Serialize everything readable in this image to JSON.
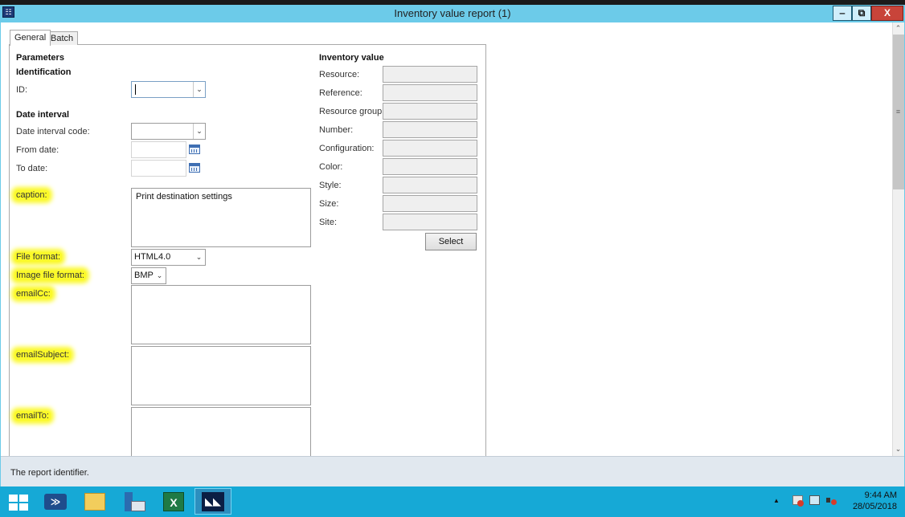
{
  "window": {
    "title": "Inventory value report (1)",
    "app_icon": "☷",
    "controls": {
      "minimize": "‒",
      "maximize": "⧉",
      "close": "X"
    }
  },
  "tabs": [
    {
      "label": "General",
      "active": true
    },
    {
      "label": "Batch",
      "active": false
    }
  ],
  "parameters": {
    "heading": "Parameters",
    "identification": {
      "heading": "Identification",
      "id_label": "ID:",
      "id_value": ""
    },
    "date_interval": {
      "heading": "Date interval",
      "code_label": "Date interval code:",
      "code_value": "",
      "from_label": "From date:",
      "from_value": "",
      "to_label": "To date:",
      "to_value": ""
    },
    "caption_label": "caption:",
    "caption_value": "Print destination settings",
    "file_format_label": "File format:",
    "file_format_value": "HTML4.0",
    "image_format_label": "Image file format:",
    "image_format_value": "BMP",
    "email_cc_label": "emailCc:",
    "email_cc_value": "",
    "email_subject_label": "emailSubject:",
    "email_subject_value": "",
    "email_to_label": "emailTo:",
    "email_to_value": ""
  },
  "inventory_value": {
    "heading": "Inventory value",
    "fields": [
      {
        "label": "Resource:",
        "value": ""
      },
      {
        "label": "Reference:",
        "value": ""
      },
      {
        "label": "Resource group:",
        "value": ""
      },
      {
        "label": "Number:",
        "value": ""
      },
      {
        "label": "Configuration:",
        "value": ""
      },
      {
        "label": "Color:",
        "value": ""
      },
      {
        "label": "Style:",
        "value": ""
      },
      {
        "label": "Size:",
        "value": ""
      },
      {
        "label": "Site:",
        "value": ""
      }
    ],
    "select_button": "Select"
  },
  "status_text": "The report identifier.",
  "taskbar": {
    "time": "9:44 AM",
    "date": "28/05/2018",
    "tray_caret": "▲"
  },
  "highlight_color": "#fbf92a"
}
